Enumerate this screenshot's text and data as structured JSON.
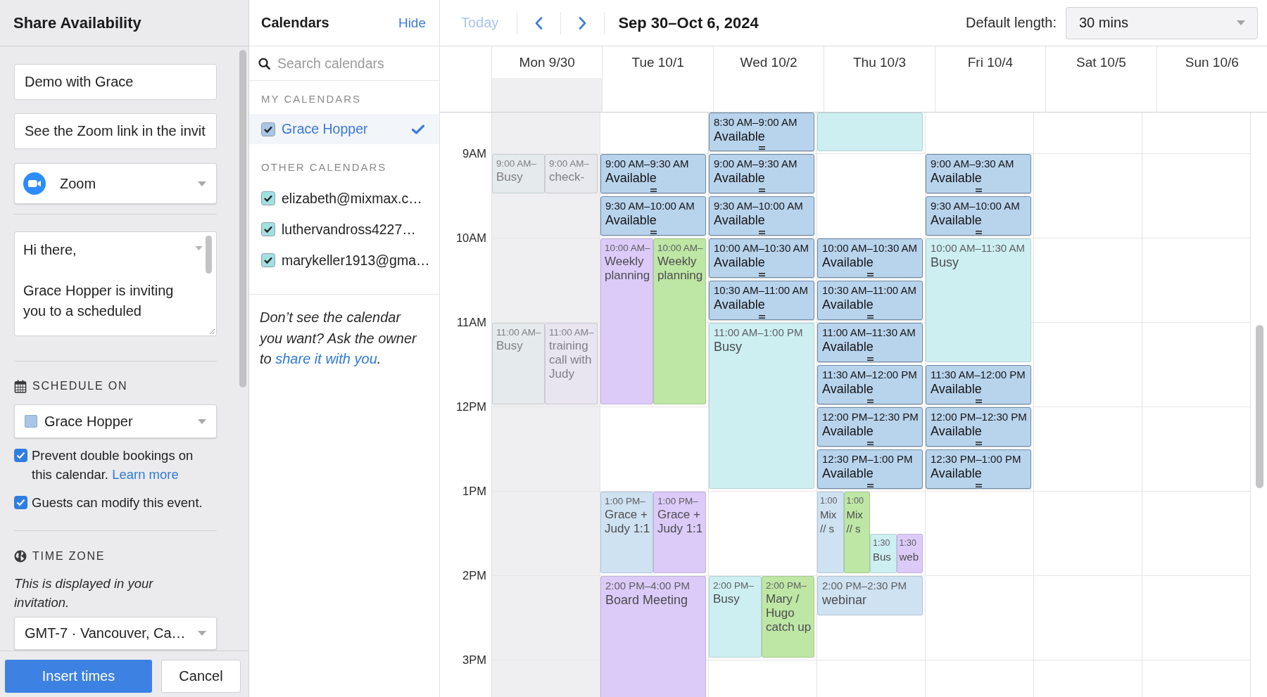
{
  "share_panel": {
    "title": "Share Availability",
    "event_title": {
      "value": "Demo with Grace"
    },
    "location": {
      "value": "See the Zoom link in the invit"
    },
    "conferencing": {
      "value": "Zoom"
    },
    "message": {
      "paragraphs": [
        "Hi there,",
        "Grace Hopper is inviting you to a scheduled"
      ]
    },
    "schedule_on": {
      "heading": "SCHEDULE ON",
      "value": "Grace Hopper"
    },
    "options": [
      {
        "label": "Prevent double bookings on this calendar.",
        "link": "Learn more",
        "checked": true
      },
      {
        "label": "Guests can modify this event.",
        "checked": true
      }
    ],
    "time_zone": {
      "heading": "TIME ZONE",
      "note": "This is displayed in your invitation.",
      "value": "GMT-7 · Vancouver, Ca…"
    },
    "buttons": [
      {
        "label": "Insert times",
        "kind": "primary"
      },
      {
        "label": "Cancel",
        "kind": "secondary"
      }
    ]
  },
  "calendars_panel": {
    "title": "Calendars",
    "hide_link": "Hide",
    "search": {
      "placeholder": "Search calendars"
    },
    "groups": [
      {
        "heading": "MY CALENDARS",
        "items": [
          {
            "label": "Grace Hopper",
            "checked": true,
            "selected": true,
            "color": "#a8c6e6"
          }
        ]
      },
      {
        "heading": "OTHER CALENDARS",
        "items": [
          {
            "label": "elizabeth@mixmax.c…",
            "checked": true,
            "selected": false,
            "color": "#a2dfe0"
          },
          {
            "label": "luthervandross4227…",
            "checked": true,
            "selected": false,
            "color": "#a2dfe0"
          },
          {
            "label": "marykeller1913@gma…",
            "checked": true,
            "selected": false,
            "color": "#a2dfe0"
          }
        ]
      }
    ],
    "note": {
      "text": "Don’t see the calendar you want? Ask the owner to",
      "link": "share it with you",
      "end": "."
    }
  },
  "toolbar": {
    "today": {
      "label": "Today",
      "disabled": true
    },
    "date_range": "Sep 30–Oct 6, 2024",
    "default_length": {
      "label": "Default length:",
      "value": "30 mins"
    }
  },
  "calendar": {
    "hours": [
      "9AM",
      "10AM",
      "11AM",
      "12PM",
      "1PM",
      "2PM",
      "3PM"
    ],
    "days": [
      {
        "label": "Mon 9/30",
        "past": true,
        "events": [
          {
            "kind": "event",
            "time": "9:00 AM–",
            "title": "Busy",
            "color": "#e5eaed"
          },
          {
            "kind": "event",
            "time": "9:00 AM–",
            "title": "check-",
            "color": "#e7e9ee"
          },
          {
            "kind": "event",
            "time": "11:00 AM–",
            "title": "Busy",
            "color": "#e5eaed"
          },
          {
            "kind": "event",
            "time": "11:00 AM–",
            "title": "training call with Judy",
            "color": "#e8e5f1"
          }
        ]
      },
      {
        "label": "Tue 10/1",
        "past": false,
        "events": [
          {
            "kind": "available",
            "time": "9:00 AM–9:30 AM",
            "title": "Available",
            "color": "#b8d3ec"
          },
          {
            "kind": "available",
            "time": "9:30 AM–10:00 AM",
            "title": "Available",
            "color": "#b8d3ec"
          },
          {
            "kind": "event",
            "time": "10:00 AM–",
            "title": "Weekly planning",
            "color": "#dccbf8"
          },
          {
            "kind": "event",
            "time": "10:00 AM–",
            "title": "Weekly planning",
            "color": "#bee6a4"
          },
          {
            "kind": "event",
            "time": "1:00 PM–",
            "title": "Grace + Judy 1:1",
            "color": "#cfe2f1"
          },
          {
            "kind": "event",
            "time": "1:00 PM–",
            "title": "Grace + Judy 1:1",
            "color": "#dccbf8"
          },
          {
            "kind": "event",
            "time": "2:00 PM–4:00 PM",
            "title": "Board Meeting",
            "color": "#dccbf8"
          }
        ]
      },
      {
        "label": "Wed 10/2",
        "past": false,
        "events": [
          {
            "kind": "available",
            "time": "8:30 AM–9:00 AM",
            "title": "Available",
            "color": "#b8d3ec"
          },
          {
            "kind": "available",
            "time": "9:00 AM–9:30 AM",
            "title": "Available",
            "color": "#b8d3ec"
          },
          {
            "kind": "available",
            "time": "9:30 AM–10:00 AM",
            "title": "Available",
            "color": "#b8d3ec"
          },
          {
            "kind": "available",
            "time": "10:00 AM–10:30 AM",
            "title": "Available",
            "color": "#b8d3ec"
          },
          {
            "kind": "available",
            "time": "10:30 AM–11:00 AM",
            "title": "Available",
            "color": "#b8d3ec"
          },
          {
            "kind": "event",
            "time": "11:00 AM–1:00 PM",
            "title": "Busy",
            "color": "#cdeff2"
          },
          {
            "kind": "event",
            "time": "2:00 PM–",
            "title": "Busy",
            "color": "#cdeff2"
          },
          {
            "kind": "event",
            "time": "2:00 PM–",
            "title": "Mary / Hugo catch up",
            "color": "#bee6a4"
          }
        ]
      },
      {
        "label": "Thu 10/3",
        "past": false,
        "events": [
          {
            "kind": "event",
            "color": "#cdeff2"
          },
          {
            "kind": "available",
            "time": "10:00 AM–10:30 AM",
            "title": "Available",
            "color": "#b8d3ec"
          },
          {
            "kind": "available",
            "time": "10:30 AM–11:00 AM",
            "title": "Available",
            "color": "#b8d3ec"
          },
          {
            "kind": "available",
            "time": "11:00 AM–11:30 AM",
            "title": "Available",
            "color": "#b8d3ec"
          },
          {
            "kind": "available",
            "time": "11:30 AM–12:00 PM",
            "title": "Available",
            "color": "#b8d3ec"
          },
          {
            "kind": "available",
            "time": "12:00 PM–12:30 PM",
            "title": "Available",
            "color": "#b8d3ec"
          },
          {
            "kind": "available",
            "time": "12:30 PM–1:00 PM",
            "title": "Available",
            "color": "#b8d3ec"
          },
          {
            "kind": "event",
            "time": "1:00",
            "title": "Mix // s",
            "color": "#cfe2f1"
          },
          {
            "kind": "event",
            "time": "1:00",
            "title": "Mix // s",
            "color": "#bee6a4"
          },
          {
            "kind": "event",
            "time": "1:30",
            "title": "Bus",
            "color": "#cdeff2"
          },
          {
            "kind": "event",
            "time": "1:30",
            "title": "web",
            "color": "#dccbf8"
          },
          {
            "kind": "event",
            "time": "2:00 PM–2:30 PM",
            "title": "webinar",
            "color": "#cfe2f1"
          }
        ]
      },
      {
        "label": "Fri 10/4",
        "past": false,
        "events": [
          {
            "kind": "available",
            "time": "9:00 AM–9:30 AM",
            "title": "Available",
            "color": "#b8d3ec"
          },
          {
            "kind": "available",
            "time": "9:30 AM–10:00 AM",
            "title": "Available",
            "color": "#b8d3ec"
          },
          {
            "kind": "event",
            "time": "10:00 AM–11:30 AM",
            "title": "Busy",
            "color": "#cdeff2"
          },
          {
            "kind": "available",
            "time": "11:30 AM–12:00 PM",
            "title": "Available",
            "color": "#b8d3ec"
          },
          {
            "kind": "available",
            "time": "12:00 PM–12:30 PM",
            "title": "Available",
            "color": "#b8d3ec"
          },
          {
            "kind": "available",
            "time": "12:30 PM–1:00 PM",
            "title": "Available",
            "color": "#b8d3ec"
          }
        ]
      },
      {
        "label": "Sat 10/5",
        "past": false
      },
      {
        "label": "Sun 10/6",
        "past": false
      }
    ]
  }
}
